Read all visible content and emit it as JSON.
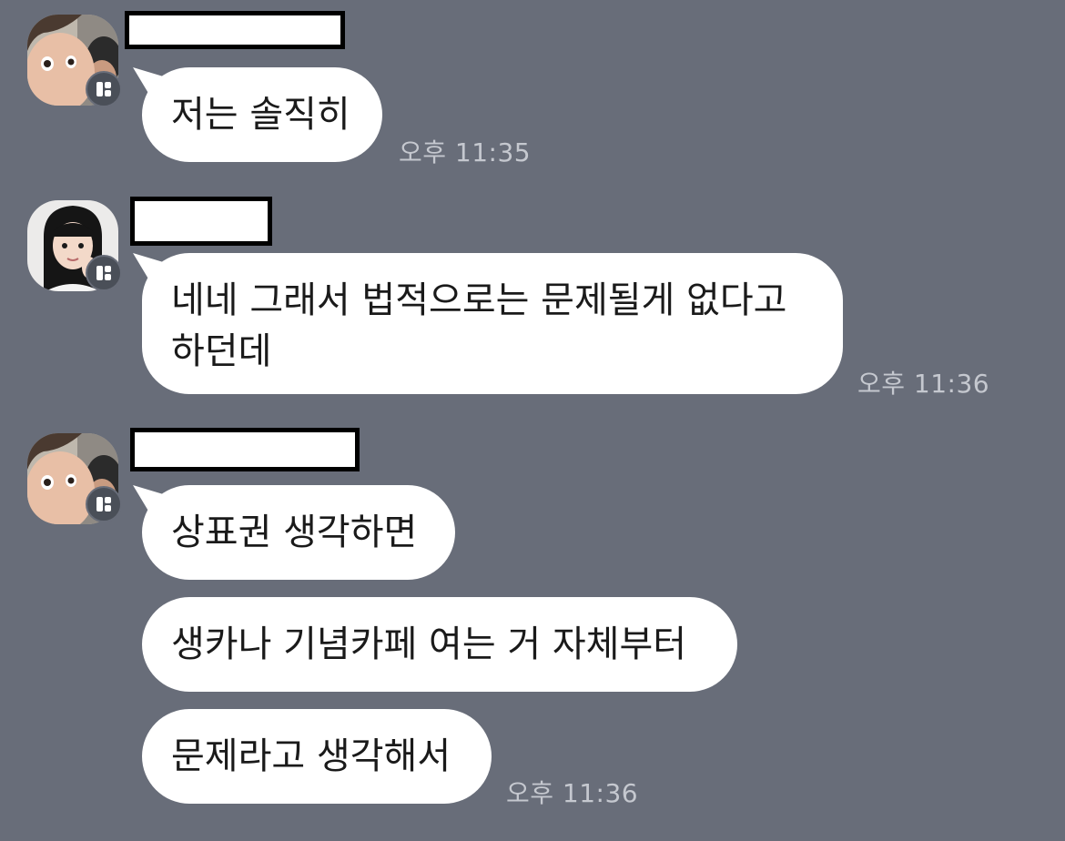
{
  "messages": [
    {
      "avatar": "avatar-girl-selfie",
      "lines": [
        "저는 솔직히"
      ],
      "time": "오후 11:35"
    },
    {
      "avatar": "avatar-girl-dark-hair",
      "lines": [
        "네네 그래서 법적으로는 문제될게 없다고\n하던데"
      ],
      "time": "오후 11:36"
    },
    {
      "avatar": "avatar-girl-selfie",
      "lines": [
        "상표권 생각하면",
        "생카나 기념카페 여는 거 자체부터",
        "문제라고 생각해서"
      ],
      "time": "오후 11:36"
    }
  ],
  "colors": {
    "background": "#686d79",
    "bubble": "#ffffff",
    "timestamp": "#c5c8cf",
    "badge": "#4a4f58",
    "redaction_border": "#000000"
  },
  "icons": {
    "profile_badge": "open-chat-profile-icon"
  }
}
